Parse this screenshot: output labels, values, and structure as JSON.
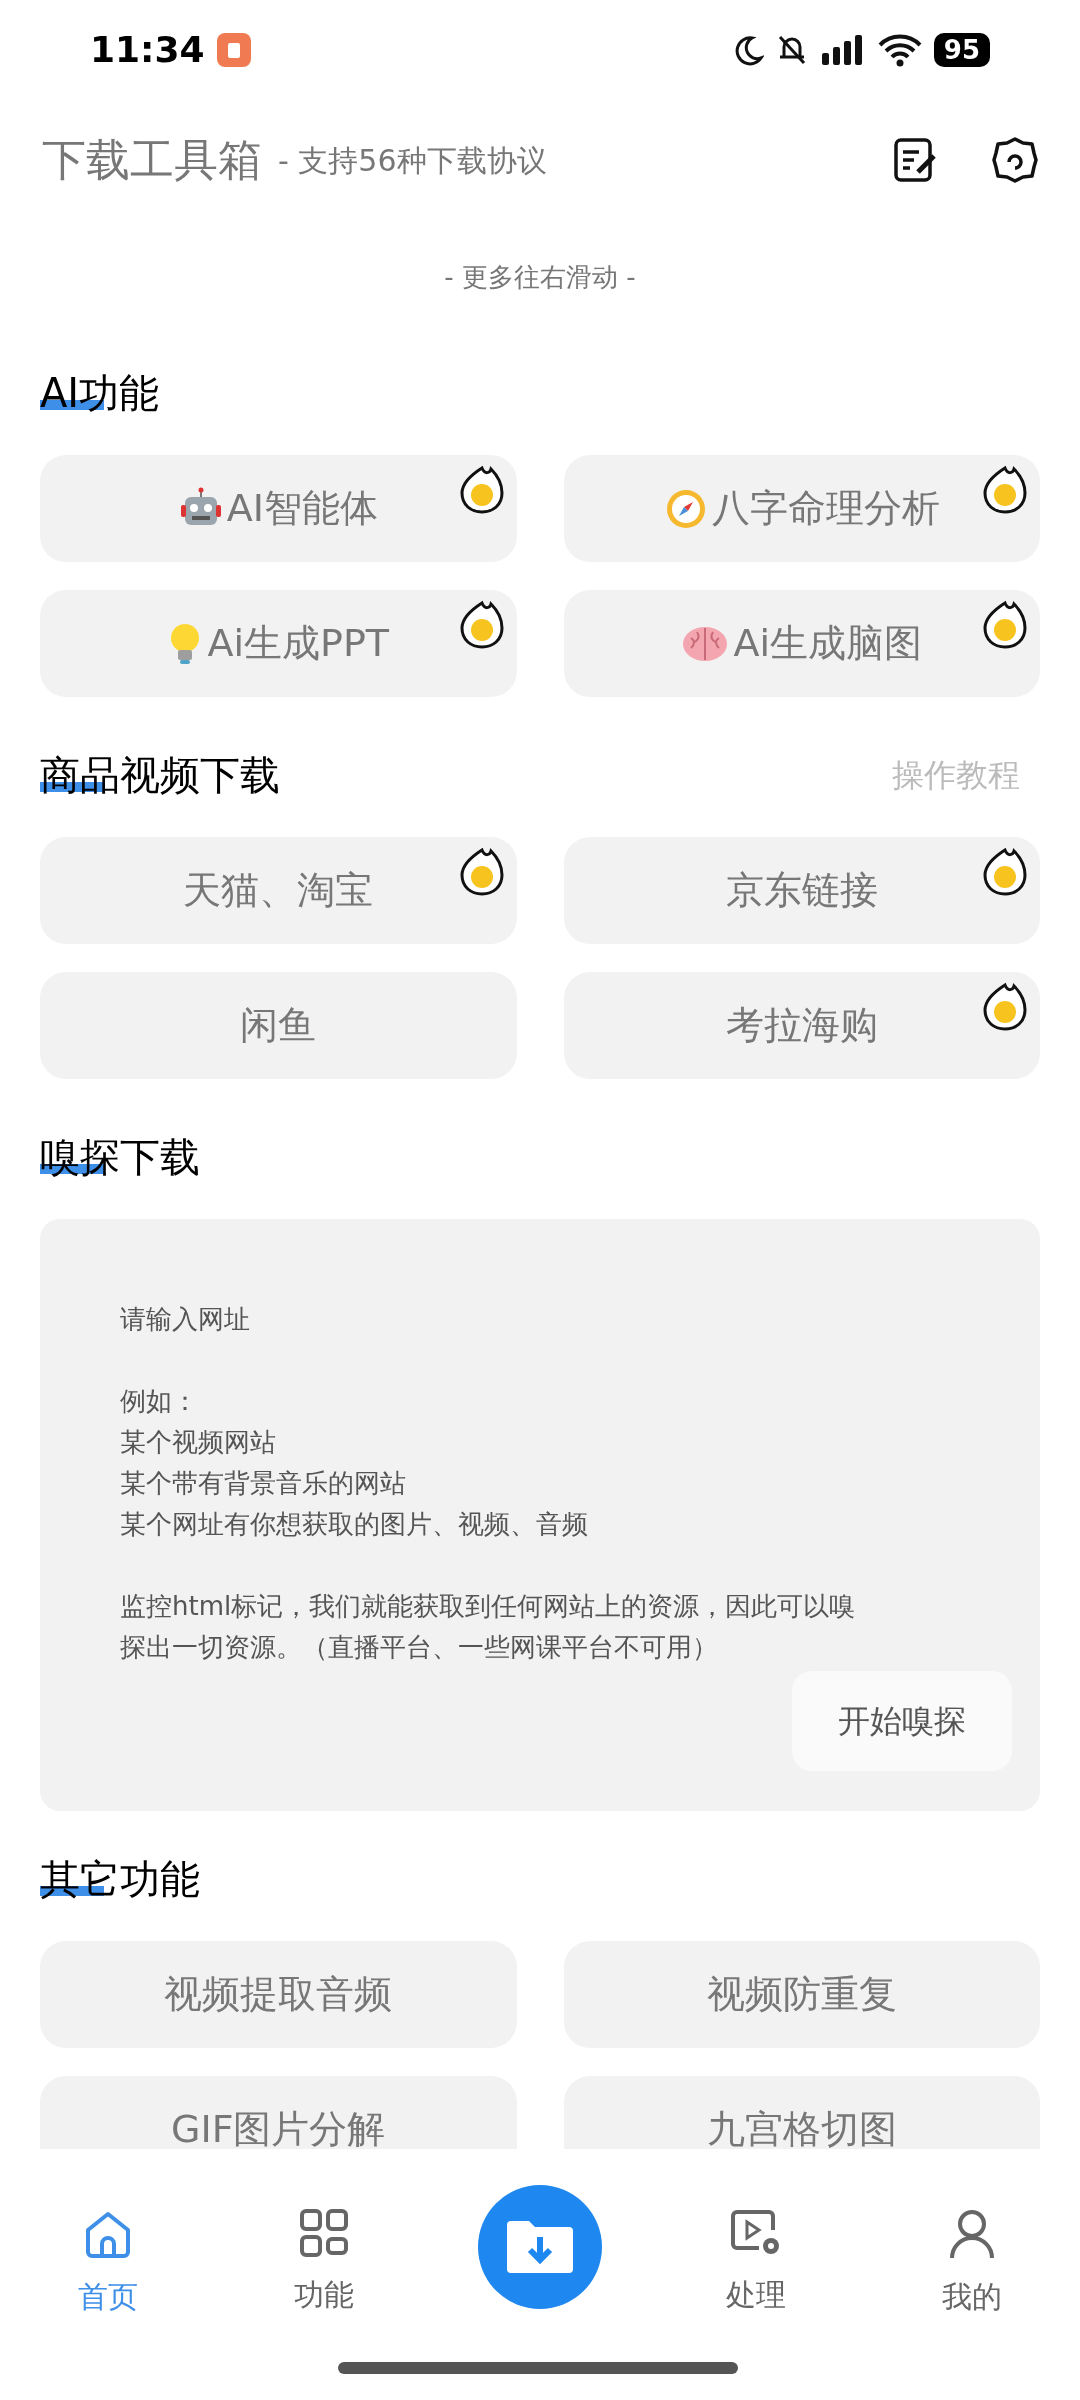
{
  "status_bar": {
    "time": "11:34",
    "battery": "95"
  },
  "header": {
    "title": "下载工具箱",
    "subtitle": "- 支持56种下载协议"
  },
  "hint": "- 更多往右滑动 -",
  "sections": [
    {
      "title": "AI功能",
      "kind": "grid",
      "items": [
        {
          "label": "AI智能体",
          "hot": true
        },
        {
          "label": "八字命理分析",
          "hot": true
        },
        {
          "label": "Ai生成PPT",
          "hot": true
        },
        {
          "label": "Ai生成脑图",
          "hot": true
        }
      ]
    },
    {
      "title": "商品视频下载",
      "kind": "grid",
      "link": "操作教程",
      "items": [
        {
          "label": "天猫、淘宝",
          "hot": true
        },
        {
          "label": "京东链接",
          "hot": true
        },
        {
          "label": "闲鱼",
          "hot": false
        },
        {
          "label": "考拉海购",
          "hot": true
        }
      ]
    },
    {
      "title": "嗅探下载",
      "kind": "sniff",
      "placeholder_paragraphs": [
        [
          "请输入网址"
        ],
        [
          "例如：",
          "某个视频网站",
          "某个带有背景音乐的网站",
          "某个网址有你想获取的图片、视频、音频"
        ],
        [
          "监控html标记，我们就能获取到任何网站上的资源，因此可以嗅探出一切资源。（直播平台、一些网课平台不可用）"
        ]
      ],
      "button": "开始嗅探"
    },
    {
      "title": "其它功能",
      "kind": "grid",
      "items": [
        {
          "label": "视频提取音频",
          "hot": false
        },
        {
          "label": "视频防重复",
          "hot": false
        },
        {
          "label": "GIF图片分解",
          "hot": false
        },
        {
          "label": "九宫格切图",
          "hot": false
        }
      ]
    }
  ],
  "nav": [
    {
      "label": "首页",
      "selected": true
    },
    {
      "label": "功能",
      "selected": false
    },
    {
      "kind": "fab"
    },
    {
      "label": "处理",
      "selected": false
    },
    {
      "label": "我的",
      "selected": false
    }
  ]
}
